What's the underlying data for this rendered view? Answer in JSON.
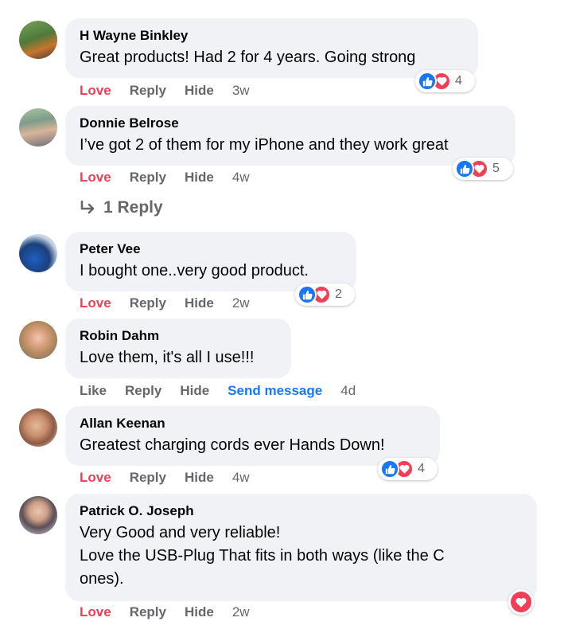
{
  "colors": {
    "love": "#f33e58",
    "like_blue": "#1877f2",
    "bubble": "#f0f2f5",
    "meta": "#65676b"
  },
  "icons": {
    "like": "thumbs-up-icon",
    "love": "heart-icon",
    "reply_arrow": "reply-arrow-icon"
  },
  "comments": [
    {
      "name": "H Wayne Binkley",
      "text": [
        "Great products! Had 2 for 4 years. Going strong"
      ],
      "action1": "Love",
      "reply": "Reply",
      "hide": "Hide",
      "time": "3w",
      "reaction_count": "4"
    },
    {
      "name": "Donnie Belrose",
      "text": [
        "I’ve got 2 of them for my iPhone and they work great"
      ],
      "action1": "Love",
      "reply": "Reply",
      "hide": "Hide",
      "time": "4w",
      "reaction_count": "5",
      "replies_link": "1 Reply"
    },
    {
      "name": "Peter Vee",
      "text": [
        "I bought one..very good product."
      ],
      "action1": "Love",
      "reply": "Reply",
      "hide": "Hide",
      "time": "2w",
      "reaction_count": "2"
    },
    {
      "name": "Robin Dahm",
      "text": [
        "Love them, it's all I use!!!"
      ],
      "action1": "Like",
      "reply": "Reply",
      "hide": "Hide",
      "send": "Send message",
      "time": "4d"
    },
    {
      "name": "Allan Keenan",
      "text": [
        "Greatest charging cords ever Hands Down!"
      ],
      "action1": "Love",
      "reply": "Reply",
      "hide": "Hide",
      "time": "4w",
      "reaction_count": "4"
    },
    {
      "name": "Patrick O. Joseph",
      "text": [
        "Very Good and very reliable!",
        "Love the USB-Plug That fits in both ways (like the C",
        "ones)."
      ],
      "action1": "Love",
      "reply": "Reply",
      "hide": "Hide",
      "time": "2w"
    }
  ]
}
